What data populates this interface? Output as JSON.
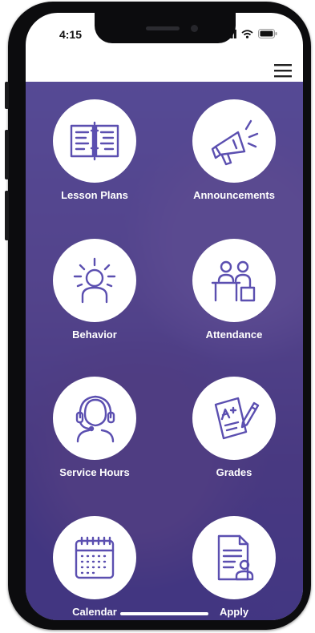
{
  "status_bar": {
    "time": "4:15",
    "icons": [
      "signal-icon",
      "wifi-icon",
      "battery-icon"
    ]
  },
  "header": {
    "menu_icon": "hamburger-icon"
  },
  "theme": {
    "overlay_color": "#483a96",
    "icon_stroke": "#5b4fb0",
    "label_color": "#ffffff"
  },
  "tiles": [
    {
      "label": "Lesson Plans",
      "icon": "lesson-plans-icon"
    },
    {
      "label": "Announcements",
      "icon": "megaphone-icon"
    },
    {
      "label": "Behavior",
      "icon": "behavior-icon"
    },
    {
      "label": "Attendance",
      "icon": "attendance-icon"
    },
    {
      "label": "Service Hours",
      "icon": "headset-icon"
    },
    {
      "label": "Grades",
      "icon": "grades-icon"
    },
    {
      "label": "Calendar",
      "icon": "calendar-icon"
    },
    {
      "label": "Apply",
      "icon": "apply-document-icon"
    }
  ]
}
